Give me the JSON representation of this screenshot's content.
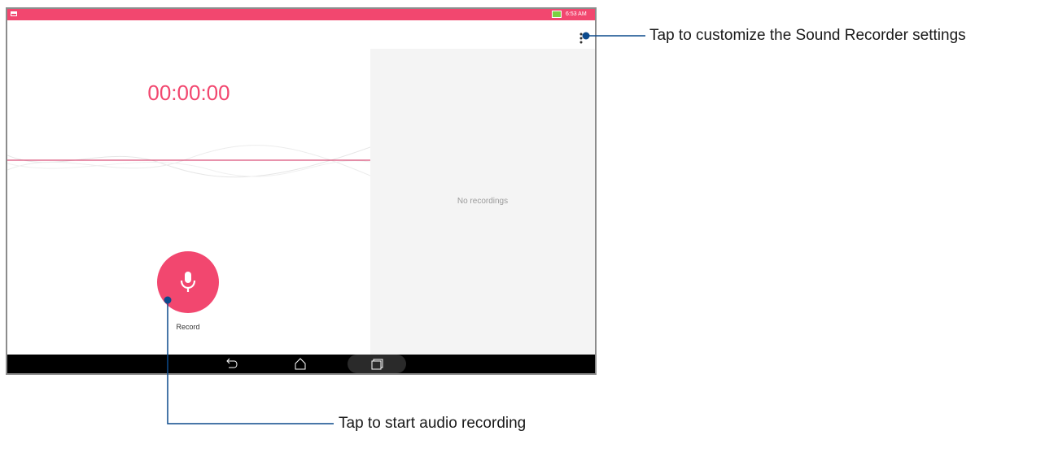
{
  "status_bar": {
    "time": "6:53 AM",
    "color": "#f2476f",
    "battery_color": "#7cd142",
    "left_icon": "notification-icon",
    "battery_icon": "battery-charging-icon"
  },
  "app_bar": {
    "menu_icon": "kebab-menu-icon"
  },
  "recorder": {
    "timer": "00:00:00",
    "record_label": "Record",
    "record_icon": "microphone-icon",
    "accent_color": "#f2476f"
  },
  "recordings_panel": {
    "empty_text": "No recordings"
  },
  "nav_bar": {
    "items": [
      {
        "name": "back",
        "icon": "back-icon"
      },
      {
        "name": "home",
        "icon": "home-icon"
      },
      {
        "name": "recent-apps",
        "icon": "recent-apps-icon"
      }
    ]
  },
  "callouts": {
    "settings": "Tap to customize the Sound Recorder settings",
    "record": "Tap to start audio recording",
    "line_color": "#0c4a8c"
  }
}
